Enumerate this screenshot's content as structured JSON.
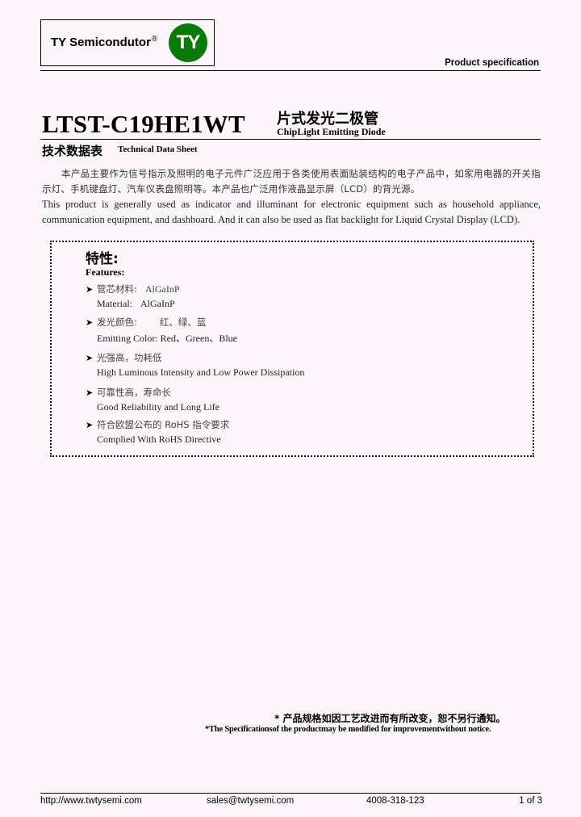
{
  "header": {
    "logo_text": "TY Semicondutor",
    "logo_registered": "®",
    "logo_mark": "TY",
    "logo_color": "#08790b",
    "doc_type": "Product specification"
  },
  "title": {
    "part_number": "LTST-C19HE1WT",
    "product_cn": "片式发光二极管",
    "product_en": "ChipLight Emitting Diode",
    "sheet_cn": "技术数据表",
    "sheet_en": "Technical Data Sheet"
  },
  "intro": {
    "cn": "本产品主要作为信号指示及照明的电子元件广泛应用于各类使用表面贴装结构的电子产品中，如家用电器的开关指示灯、手机键盘灯、汽车仪表盘照明等。本产品也广泛用作液晶显示屏（LCD）的背光源。",
    "en": "This product is generally used as indicator and illuminant for electronic equipment such as household appliance, communication equipment, and dashboard. And it can also be used as flat backlight for Liquid Crystal Display (LCD)."
  },
  "features": {
    "heading_cn": "特性:",
    "heading_en": "Features:",
    "items": [
      {
        "cn": "管芯材料:",
        "cn_value": "AlGaInP",
        "en": "Material:",
        "en_value": "AlGaInP"
      },
      {
        "cn": "发光颜色:",
        "cn_value": "红、绿、蓝",
        "en": "Emitting Color:",
        "en_value": "Red、Green、Blue"
      },
      {
        "cn": "光强高，功耗低",
        "en": "High Luminous Intensity and Low Power Dissipation"
      },
      {
        "cn": "可靠性高，寿命长",
        "en": "Good Reliability and Long Life"
      },
      {
        "cn": "符合欧盟公布的 RoHS 指令要求",
        "en": "Complied With RoHS Directive"
      }
    ]
  },
  "notice": {
    "cn": "* 产品规格如因工艺改进而有所改变，恕不另行通知。",
    "en": "*The Specificationsof the productmay be modified for improvementwithout notice."
  },
  "footer": {
    "website": "http://www.twtysemi.com",
    "email": "sales@twtysemi.com",
    "phone": "4008-318-123",
    "page": "1 of 3"
  }
}
